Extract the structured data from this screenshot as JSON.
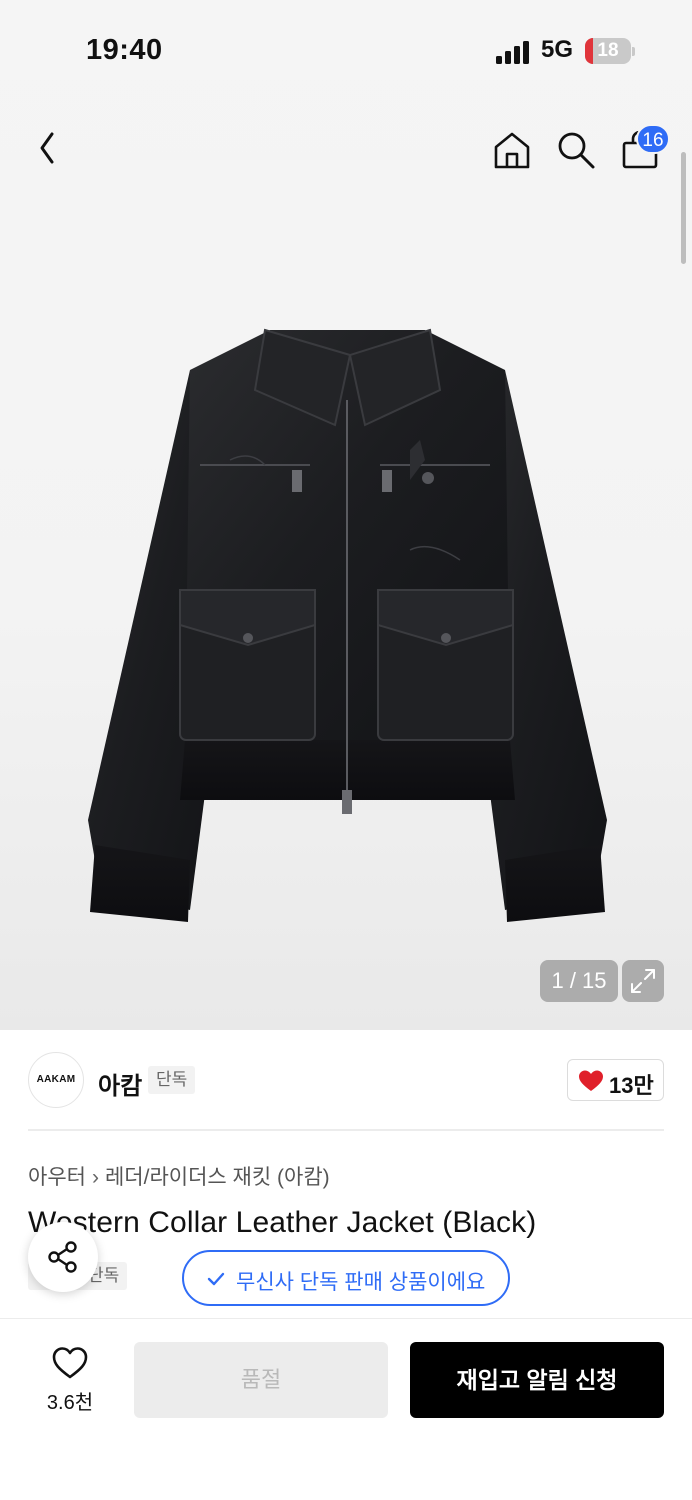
{
  "status_bar": {
    "time": "19:40",
    "network": "5G",
    "battery_level": "18",
    "battery_fraction": 0.18
  },
  "header": {
    "icons": [
      "back-icon",
      "home-icon",
      "search-icon",
      "shopping-bag-icon"
    ],
    "cart_count": "16"
  },
  "gallery": {
    "counter": "1 / 15",
    "expand_icon": "expand-icon"
  },
  "brand": {
    "logo_text": "AAKAM",
    "name": "아캄",
    "badge": "단독",
    "like_count": "13만"
  },
  "product": {
    "breadcrumb": [
      "아우터",
      "레더/라이더스 재킷 (아캄)"
    ],
    "title": "Western Collar Leather Jacket (Black)",
    "tag": "단독",
    "musinsa_notice": "무신사 단독 판매 상품이에요"
  },
  "bottom_bar": {
    "wish_count": "3.6천",
    "soldout_label": "품절",
    "restock_label": "재입고 알림 신청"
  },
  "colors": {
    "accent_blue": "#2f6cf6",
    "heart_red": "#e0202a",
    "battery_red": "#e0353b"
  }
}
